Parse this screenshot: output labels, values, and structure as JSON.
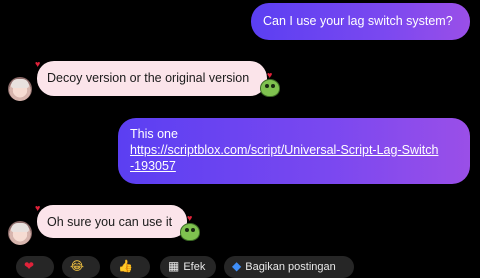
{
  "messages": [
    {
      "sender": "me",
      "text": "Can I use your lag switch system?"
    },
    {
      "sender": "them",
      "text": "Decoy version or the original version"
    },
    {
      "sender": "me",
      "text": "This one",
      "link_line1": "https://scriptblox.com/script/Universal-Script-Lag-Switch",
      "link_line2": "-193057"
    },
    {
      "sender": "them",
      "text": "Oh sure you can use it"
    }
  ],
  "reactions": {
    "heart_icon": "❤",
    "laugh_icon": "😂",
    "like_icon": "👍",
    "effect_label": "Efek",
    "share_label": "Bagikan postingan"
  },
  "colors": {
    "sent_bubble_start": "#5b3ff2",
    "sent_bubble_end": "#9a4fe8",
    "received_bubble": "#fbe4ea",
    "background": "#000000"
  }
}
